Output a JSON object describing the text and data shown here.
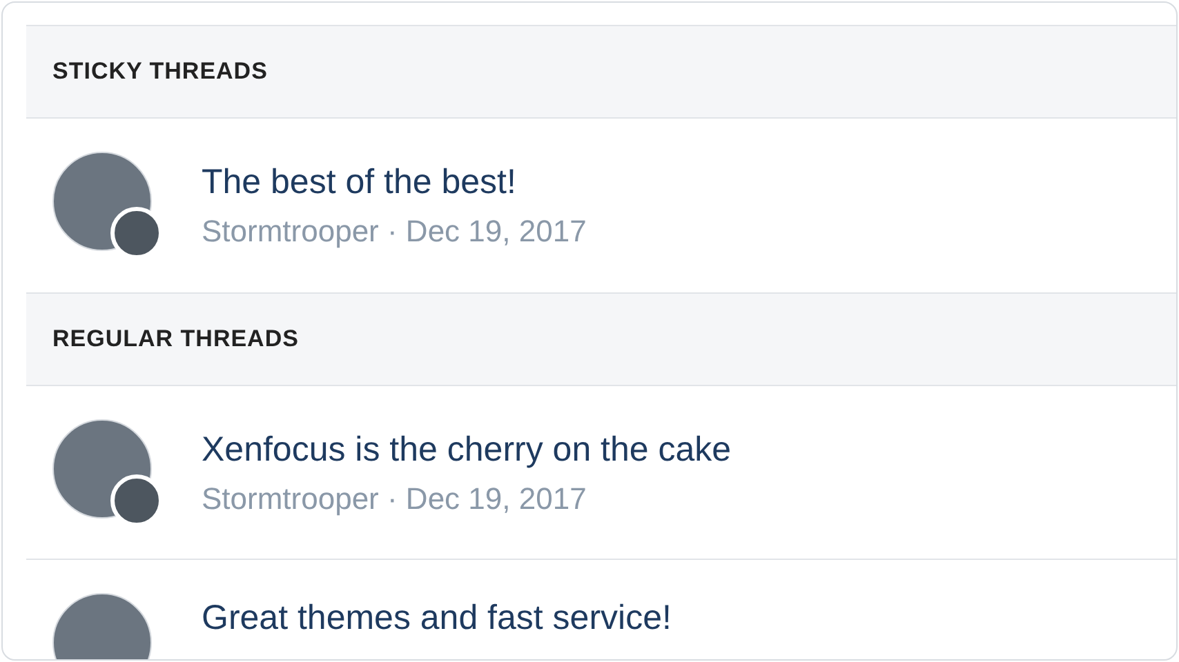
{
  "sections": [
    {
      "title": "STICKY THREADS",
      "threads": [
        {
          "title": "The best of the best!",
          "meta": "Stormtrooper · Dec 19, 2017",
          "secondary_avatar": true
        }
      ]
    },
    {
      "title": "REGULAR THREADS",
      "threads": [
        {
          "title": "Xenfocus is the cherry on the cake",
          "meta": "Stormtrooper · Dec 19, 2017",
          "secondary_avatar": true
        },
        {
          "title": "Great themes and fast service!",
          "secondary_avatar": false
        }
      ]
    }
  ]
}
